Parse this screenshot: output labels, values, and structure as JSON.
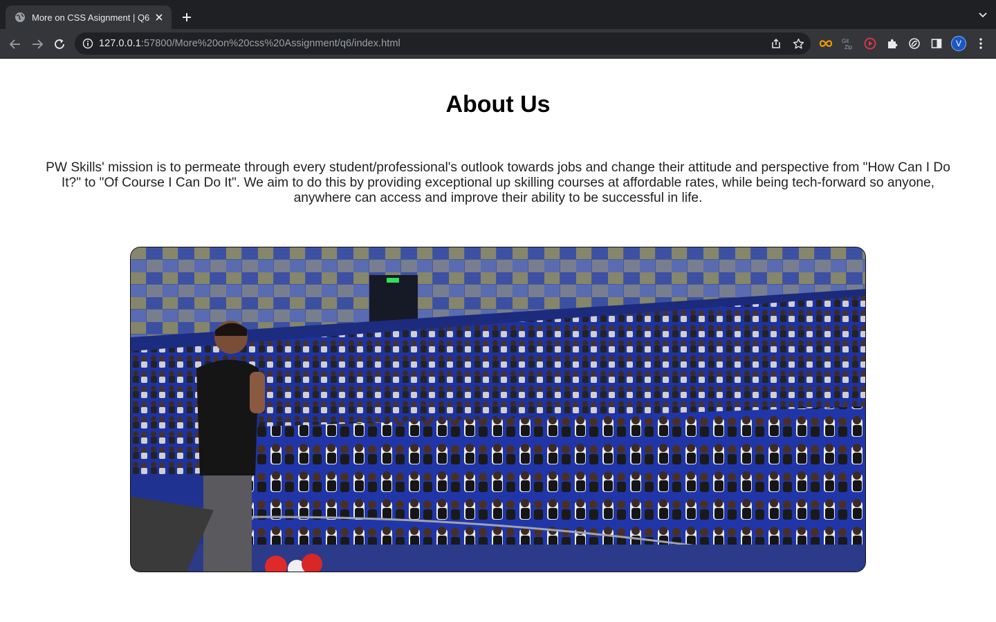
{
  "browser": {
    "tab_title": "More on CSS Asignment | Q6",
    "url_host": "127.0.0.1",
    "url_rest": ":57800/More%20on%20css%20Assignment/q6/index.html",
    "profile_initial": "V"
  },
  "page": {
    "heading": "About Us",
    "mission": "PW Skills' mission is to permeate through every student/professional's outlook towards jobs and change their attitude and perspective from \"How Can I Do It?\" to \"Of Course I Can Do It\". We aim to do this by providing exceptional up skilling courses at affordable rates, while being tech-forward so anyone, anywhere can access and improve their ability to be successful in life.",
    "image": "auditorium-event-photo"
  }
}
